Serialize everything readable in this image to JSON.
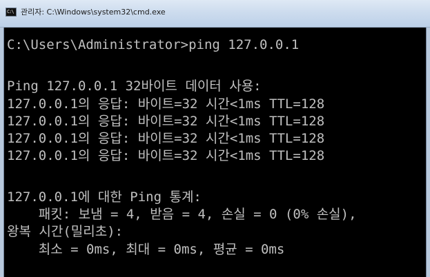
{
  "window": {
    "title": "관리자: C:\\Windows\\system32\\cmd.exe",
    "icon": "cmd-icon",
    "icon_text": "C:\\"
  },
  "console": {
    "lines": [
      "C:\\Users\\Administrator>ping 127.0.0.1",
      "",
      "Ping 127.0.0.1 32바이트 데이터 사용:",
      "127.0.0.1의 응답: 바이트=32 시간<1ms TTL=128",
      "127.0.0.1의 응답: 바이트=32 시간<1ms TTL=128",
      "127.0.0.1의 응답: 바이트=32 시간<1ms TTL=128",
      "127.0.0.1의 응답: 바이트=32 시간<1ms TTL=128",
      "",
      "127.0.0.1에 대한 Ping 통계:",
      "    패킷: 보냄 = 4, 받음 = 4, 손실 = 0 (0% 손실),",
      "왕복 시간(밀리초):",
      "    최소 = 0ms, 최대 = 0ms, 평균 = 0ms"
    ]
  },
  "colors": {
    "console_bg": "#000000",
    "console_text": "#c0c0c0"
  }
}
